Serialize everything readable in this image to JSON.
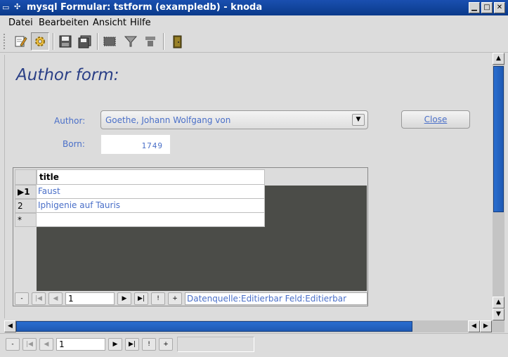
{
  "window": {
    "title": "mysql Formular: tstform (exampledb) - knoda",
    "controls": [
      "minimize-icon",
      "maximize-icon",
      "close-icon"
    ]
  },
  "menu": {
    "items": [
      {
        "label": "Datei",
        "accel": "D"
      },
      {
        "label": "Bearbeiten",
        "accel": "B"
      },
      {
        "label": "Ansicht",
        "accel": "A"
      },
      {
        "label": "Hilfe",
        "accel": "H"
      }
    ]
  },
  "toolbar": {
    "icons": [
      "edit-icon",
      "run-gear-icon",
      "save-icon",
      "save-as-icon",
      "print-icon",
      "filter-icon",
      "sort-icon",
      "exit-door-icon"
    ]
  },
  "form": {
    "title": "Author form:",
    "author_label": "Author:",
    "author_value": "Goethe, Johann Wolfgang von",
    "born_label": "Born:",
    "born_value": "1749",
    "close_label": "Close"
  },
  "grid": {
    "column_header": "title",
    "rows": [
      {
        "head": "1",
        "current": true,
        "title": "Faust"
      },
      {
        "head": "2",
        "current": false,
        "title": "Iphigenie auf Tauris"
      },
      {
        "head": "*",
        "current": false,
        "title": ""
      }
    ],
    "navigator": {
      "record": "1",
      "buttons": [
        "-",
        "|◀",
        "◀",
        "▶",
        "▶|",
        "!",
        "+"
      ]
    },
    "status": "Datenquelle:Editierbar Feld:Editierbar"
  },
  "form_navigator": {
    "record": "1",
    "buttons": [
      "-",
      "|◀",
      "◀",
      "▶",
      "▶|",
      "!",
      "+"
    ]
  },
  "colors": {
    "titlebar": "#1a4fb0",
    "form_title": "#2a3f86",
    "label": "#4a6fc8",
    "grid_background": "#4b4c48",
    "scroll_thumb": "#2a6ed0"
  }
}
